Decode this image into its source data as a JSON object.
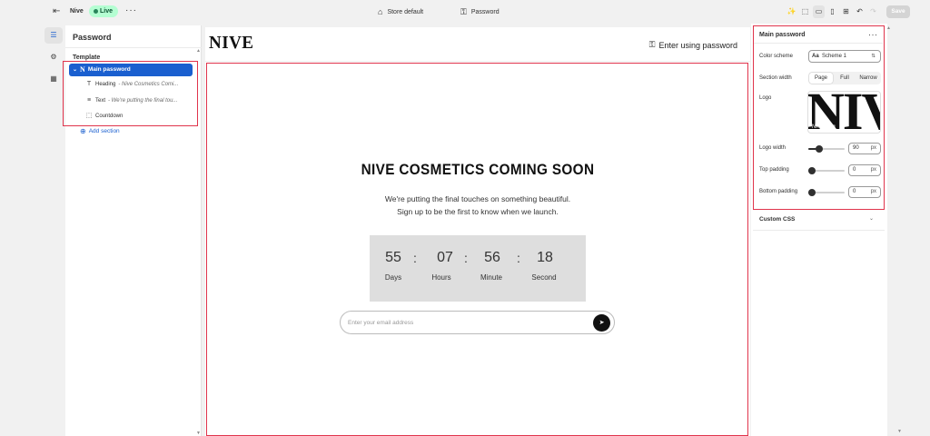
{
  "topbar": {
    "store_name": "Nive",
    "status": "Live",
    "more": "···",
    "theme": "Store default",
    "page": "Password",
    "save_label": "Save",
    "icons": [
      "exit-icon",
      "sparkle-icon",
      "inspector-icon",
      "desktop-icon",
      "mobile-icon",
      "fullwidth-icon",
      "undo-icon",
      "redo-icon"
    ]
  },
  "rail": {
    "icons": [
      "sections-icon",
      "settings-icon",
      "apps-icon"
    ]
  },
  "sidebar": {
    "title": "Password",
    "group": "Template",
    "main_section": "Main password",
    "blocks": [
      {
        "label": "Heading",
        "detail": "- Nive Cosmetics Comi..."
      },
      {
        "label": "Text",
        "detail": "- We're putting the final tou..."
      },
      {
        "label": "Countdown",
        "detail": ""
      }
    ],
    "add_section": "Add section"
  },
  "preview": {
    "logo": "NIVE",
    "enter_link": "Enter using password",
    "heading": "NIVE COSMETICS COMING SOON",
    "text_line1": "We're putting the final touches on something beautiful.",
    "text_line2": "Sign up to be the first to know when we launch.",
    "countdown": {
      "days": "55",
      "hours": "07",
      "minutes": "56",
      "seconds": "18",
      "sep": ":",
      "days_label": "Days",
      "hours_label": "Hours",
      "minutes_label": "Minute",
      "seconds_label": "Second"
    },
    "email_placeholder": "Enter your email address"
  },
  "settings": {
    "title": "Main password",
    "more": "···",
    "color_scheme_label": "Color scheme",
    "color_scheme_value": "Scheme 1",
    "color_scheme_glyph": "Aa",
    "section_width_label": "Section width",
    "section_width_options": [
      "Page",
      "Full",
      "Narrow"
    ],
    "section_width_selected": "Page",
    "logo_label": "Logo",
    "logo_preview_text": "NIV",
    "logo_file": "NIVE.png",
    "logo_width_label": "Logo width",
    "logo_width_value": "90",
    "logo_width_fraction": 0.3,
    "top_padding_label": "Top padding",
    "top_padding_value": "0",
    "top_padding_fraction": 0.0,
    "bottom_padding_label": "Bottom padding",
    "bottom_padding_value": "0",
    "bottom_padding_fraction": 0.0,
    "unit": "px",
    "custom_css_label": "Custom CSS"
  },
  "colors": {
    "accent": "#1a5fcf",
    "live_badge": "#b4fed2",
    "highlight": "#e0344c",
    "countdown_bg": "#dedede"
  }
}
